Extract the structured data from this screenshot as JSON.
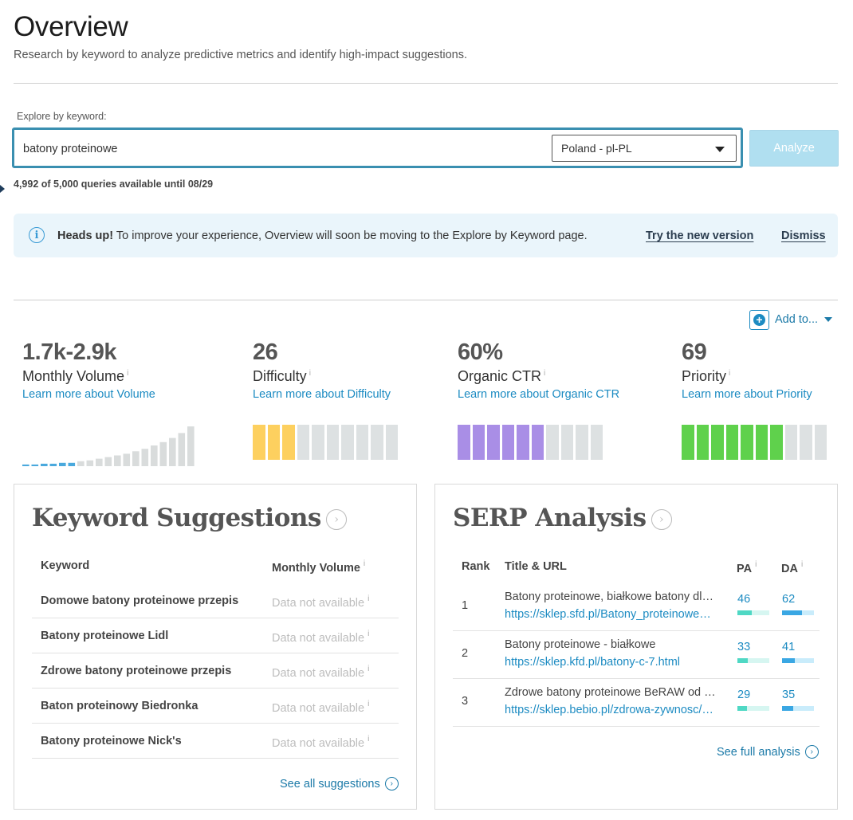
{
  "page": {
    "title": "Overview",
    "subtitle": "Research by keyword to analyze predictive metrics and identify high-impact suggestions."
  },
  "search": {
    "label": "Explore by keyword:",
    "value": "batony proteinowe",
    "locale": "Poland - pl-PL",
    "analyze_label": "Analyze",
    "queries_text": "4,992 of 5,000 queries available until 08/29"
  },
  "banner": {
    "heading": "Heads up!",
    "text": "To improve your experience, Overview will soon be moving to the Explore by Keyword page.",
    "try_link": "Try the new version",
    "dismiss": "Dismiss"
  },
  "add_to": {
    "label": "Add to..."
  },
  "metrics": [
    {
      "value": "1.7k-2.9k",
      "label": "Monthly Volume",
      "link": "Learn more about Volume"
    },
    {
      "value": "26",
      "label": "Difficulty",
      "link": "Learn more about Difficulty",
      "filled_segments": 3,
      "total_segments": 10,
      "color": "#fdd05f"
    },
    {
      "value": "60%",
      "label": "Organic CTR",
      "link": "Learn more about Organic CTR",
      "filled_segments": 6,
      "total_segments": 10,
      "color": "#a98ee6"
    },
    {
      "value": "69",
      "label": "Priority",
      "link": "Learn more about Priority",
      "filled_segments": 7,
      "total_segments": 10,
      "color": "#5fd14c"
    }
  ],
  "volume_chart": {
    "highlighted_bars": 6,
    "bar_levels": [
      0.04,
      0.04,
      0.06,
      0.06,
      0.08,
      0.08,
      0.12,
      0.14,
      0.18,
      0.22,
      0.26,
      0.3,
      0.36,
      0.42,
      0.5,
      0.58,
      0.68,
      0.8,
      0.96
    ]
  },
  "keyword_suggestions": {
    "title": "Keyword Suggestions",
    "col_keyword": "Keyword",
    "col_volume": "Monthly Volume",
    "rows": [
      {
        "keyword": "Domowe batony proteinowe przepis",
        "volume": "Data not available"
      },
      {
        "keyword": "Batony proteinowe Lidl",
        "volume": "Data not available"
      },
      {
        "keyword": "Zdrowe batony proteinowe przepis",
        "volume": "Data not available"
      },
      {
        "keyword": "Baton proteinowy Biedronka",
        "volume": "Data not available"
      },
      {
        "keyword": "Batony proteinowe Nick's",
        "volume": "Data not available"
      }
    ],
    "see_all": "See all suggestions"
  },
  "serp": {
    "title": "SERP Analysis",
    "col_rank": "Rank",
    "col_title": "Title & URL",
    "col_pa": "PA",
    "col_da": "DA",
    "rows": [
      {
        "rank": "1",
        "title": "Batony proteinowe, białkowe batony dl…",
        "url": "https://sklep.sfd.pl/Batony_proteinowe…",
        "pa": 46,
        "da": 62
      },
      {
        "rank": "2",
        "title": "Batony proteinowe - białkowe",
        "url": "https://sklep.kfd.pl/batony-c-7.html",
        "pa": 33,
        "da": 41
      },
      {
        "rank": "3",
        "title": "Zdrowe batony proteinowe BeRAW od …",
        "url": "https://sklep.bebio.pl/zdrowa-zywnosc/…",
        "pa": 29,
        "da": 35
      }
    ],
    "see_full": "See full analysis",
    "pa_color": "#4fd8c4",
    "pa_track": "#d6f6f1",
    "da_color": "#3aa7e3",
    "da_track": "#c9ecfb"
  }
}
